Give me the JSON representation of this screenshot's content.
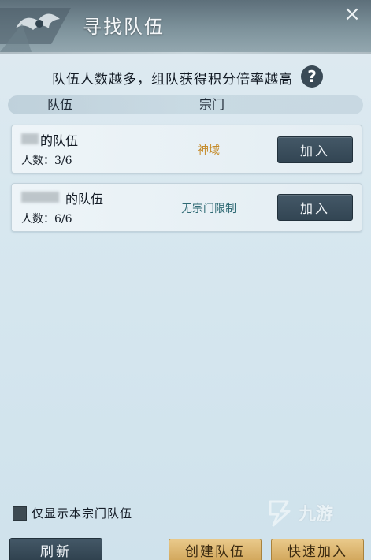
{
  "window": {
    "title": "寻找队伍",
    "close_symbol": "×"
  },
  "hint": {
    "text": "队伍人数越多，组队获得积分倍率越高",
    "help_symbol": "?"
  },
  "table": {
    "headers": {
      "team": "队伍",
      "sect": "宗门"
    },
    "rows": [
      {
        "name_suffix": "的队伍",
        "count_label": "人数：",
        "count": "3/6",
        "sect": "神域",
        "sect_color": "#c58b2a",
        "join_label": "加入"
      },
      {
        "name_suffix": "的队伍",
        "count_label": "人数：",
        "count": "6/6",
        "sect": "无宗门限制",
        "sect_color": "#2f6a74",
        "join_label": "加入"
      }
    ]
  },
  "filter": {
    "label": "仅显示本宗门队伍",
    "checked": true
  },
  "buttons": {
    "refresh": "刷新",
    "create_team": "创建队伍",
    "quick_join": "快速加入"
  },
  "watermark": {
    "text": "九游",
    "icon": "nine-game-logo-icon"
  },
  "colors": {
    "dark_button": "#3a4d5b",
    "gold_button": "#ddb56d",
    "background": "#d7e7ef"
  }
}
